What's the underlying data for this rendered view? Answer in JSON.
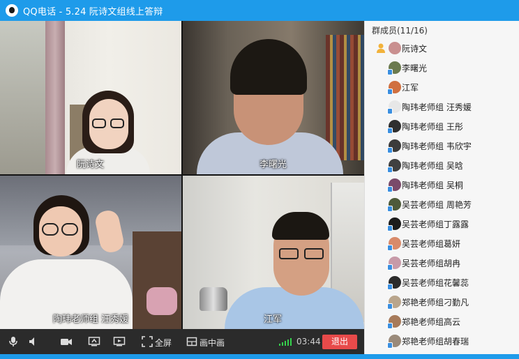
{
  "window": {
    "title": "QQ电话 - 5.24 阮诗文组线上答辩"
  },
  "participants": [
    {
      "name": "阮诗文"
    },
    {
      "name": "李曙光"
    },
    {
      "name": "陶玮老师组 汪秀媛"
    },
    {
      "name": "江军"
    }
  ],
  "toolbar": {
    "fullscreen_label": "全屏",
    "pip_label": "画中画",
    "timer": "03:44",
    "exit_label": "退出",
    "icons": [
      "microphone-icon",
      "speaker-icon",
      "camera-icon",
      "screen-share-icon",
      "presentation-icon",
      "fullscreen-icon",
      "pip-icon",
      "signal-icon"
    ],
    "exit_color": "#e84a4a"
  },
  "members": {
    "title": "群成员(11/16)",
    "list": [
      {
        "name": "阮诗文",
        "host": true,
        "avatar_color": "#c98f8f"
      },
      {
        "name": "李曙光",
        "avatar_color": "#6b7a4e"
      },
      {
        "name": "江军",
        "avatar_color": "#d07040"
      },
      {
        "name": "陶玮老师组 汪秀媛",
        "avatar_color": "#e7e7e7"
      },
      {
        "name": "陶玮老师组  王彤",
        "avatar_color": "#2f2f2f"
      },
      {
        "name": "陶玮老师组 韦欣宇",
        "avatar_color": "#3b3b3b"
      },
      {
        "name": "陶玮老师组 吴晗",
        "avatar_color": "#404040"
      },
      {
        "name": "陶玮老师组 吴桐",
        "avatar_color": "#7a4a6a"
      },
      {
        "name": "吴芸老师组 周艳芳",
        "avatar_color": "#4e5a3a"
      },
      {
        "name": "吴芸老师组丁露露",
        "avatar_color": "#1c1c1c"
      },
      {
        "name": "吴芸老师组葛妍",
        "avatar_color": "#d88a6a"
      },
      {
        "name": "吴芸老师组胡冉",
        "avatar_color": "#c79aa8"
      },
      {
        "name": "吴芸老师组花馨蕊",
        "avatar_color": "#2a2a2a"
      },
      {
        "name": "郑艳老师组刁勤凡",
        "avatar_color": "#b9a58c"
      },
      {
        "name": "郑艳老师组高云",
        "avatar_color": "#a77a5a"
      },
      {
        "name": "郑艳老师组胡春瑞",
        "avatar_color": "#9a8a7a"
      }
    ]
  },
  "colors": {
    "titlebar": "#1e9bea",
    "signal": "#35d04b"
  }
}
